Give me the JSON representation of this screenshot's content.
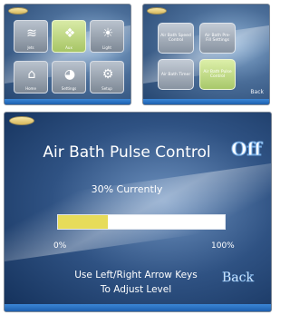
{
  "menu_screen": {
    "tiles": [
      {
        "icon": "spa-jets-icon",
        "label": "Jets"
      },
      {
        "icon": "aux-icon",
        "label": "Aux"
      },
      {
        "icon": "light-icon",
        "label": "Light"
      },
      {
        "icon": "home-icon",
        "label": "Home"
      },
      {
        "icon": "settings-icon",
        "label": "Settings"
      },
      {
        "icon": "gear-icon",
        "label": "Setup"
      }
    ],
    "active_tile": 1
  },
  "aux_screen": {
    "buttons": [
      {
        "label": "Air Bath Speed Control"
      },
      {
        "label": "Air Bath Pre-Fill Settings"
      },
      {
        "label": "Air Bath Timer"
      },
      {
        "label": "Air Bath Pulse Control"
      }
    ],
    "active_button": 3,
    "back_label": "Back"
  },
  "main_screen": {
    "title": "Air Bath Pulse Control",
    "state": "Off",
    "current_text": "30% Currently",
    "level_percent": 30,
    "min_label": "0%",
    "max_label": "100%",
    "instruction_line1": "Use Left/Right Arrow Keys",
    "instruction_line2": "To Adjust Level",
    "back_label": "Back"
  },
  "colors": {
    "bar_fill": "#e7dc5a",
    "active_tile": "#a7c565",
    "bottom_bar": "#1d5fae"
  }
}
